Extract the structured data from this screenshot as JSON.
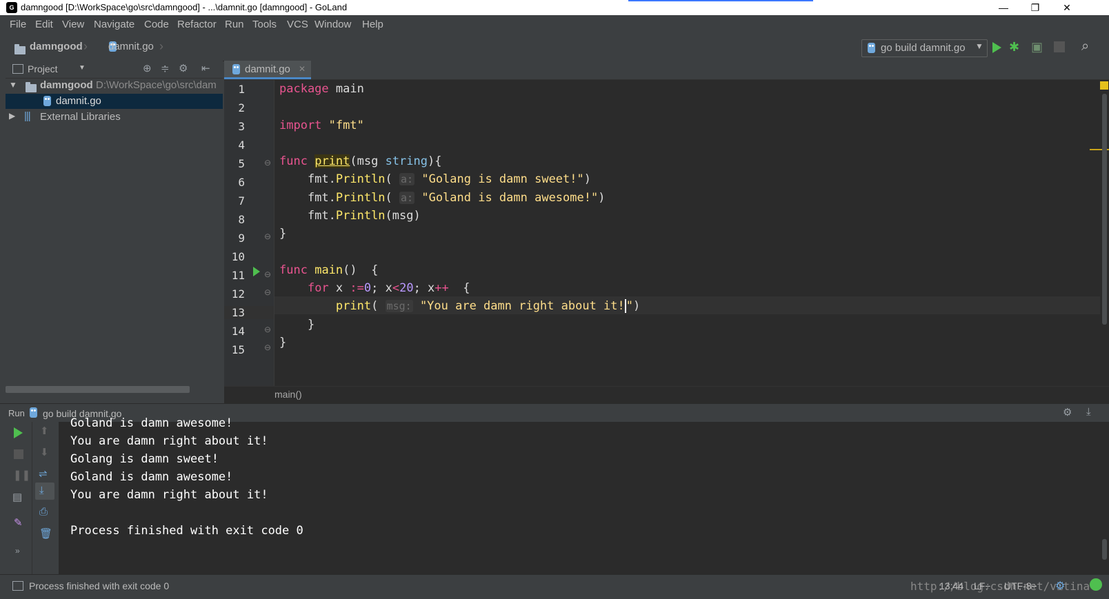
{
  "window": {
    "title": "damngood [D:\\WorkSpace\\go\\src\\damngood] - ...\\damnit.go [damngood] - GoLand",
    "minimize": "—",
    "restore": "❐",
    "close": "✕"
  },
  "menu": [
    "File",
    "Edit",
    "View",
    "Navigate",
    "Code",
    "Refactor",
    "Run",
    "Tools",
    "VCS",
    "Window",
    "Help"
  ],
  "nav": {
    "project": "damngood",
    "file": "damnit.go",
    "run_config": "go build damnit.go"
  },
  "project_panel": {
    "title": "Project",
    "root_name": "damngood",
    "root_path": "D:\\WorkSpace\\go\\src\\dam",
    "file": "damnit.go",
    "libraries": "External Libraries"
  },
  "editor": {
    "tab": "damnit.go",
    "line_numbers": [
      "1",
      "2",
      "3",
      "4",
      "5",
      "6",
      "7",
      "8",
      "9",
      "10",
      "11",
      "12",
      "13",
      "14",
      "15"
    ],
    "breadcrumb": "main()",
    "lines": {
      "l1": [
        "package",
        " main"
      ],
      "l3": [
        "import",
        " \"fmt\""
      ],
      "l5": [
        "func",
        " ",
        "print",
        "(msg ",
        "string",
        "){"
      ],
      "l6": [
        "    fmt.",
        "Println",
        "( ",
        "a:",
        " ",
        "\"Golang is damn sweet!\"",
        ")"
      ],
      "l7": [
        "    fmt.",
        "Println",
        "( ",
        "a:",
        " ",
        "\"Goland is damn awesome!\"",
        ")"
      ],
      "l8": [
        "    fmt.",
        "Println",
        "(msg)"
      ],
      "l9": [
        "}"
      ],
      "l11": [
        "func",
        " ",
        "main",
        "()  {"
      ],
      "l12": [
        "    ",
        "for",
        " x ",
        ":=",
        "0",
        "; x",
        "<",
        "20",
        "; x",
        "++",
        "  {"
      ],
      "l13": [
        "        ",
        "print",
        "( ",
        "msg:",
        " ",
        "\"You are damn right about it!",
        "\"",
        ")"
      ],
      "l14": [
        "    }"
      ],
      "l15": [
        "}"
      ]
    }
  },
  "run": {
    "label": "Run",
    "config": "go build damnit.go",
    "output": [
      "Goland is damn awesome!",
      "You are damn right about it!",
      "Golang is damn sweet!",
      "Goland is damn awesome!",
      "You are damn right about it!",
      "",
      "Process finished with exit code 0"
    ]
  },
  "status": {
    "message": "Process finished with exit code 0",
    "position": "13:44",
    "line_sep": "LF÷",
    "encoding": "UTF-8÷",
    "watermark": "http://blog.csdn.net/vitina"
  },
  "colors": {
    "keyword": "#e8548f",
    "function": "#ffe86a",
    "string": "#ffde8a",
    "type": "#86c1e6",
    "number": "#b999ff",
    "run_green": "#4fbf4f"
  }
}
